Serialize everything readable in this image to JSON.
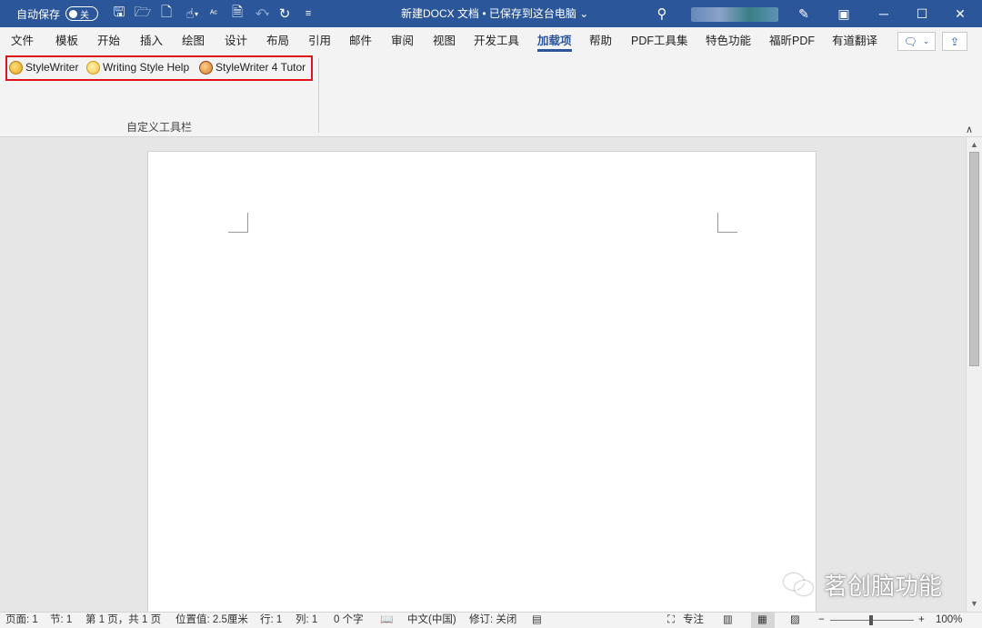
{
  "titlebar": {
    "autosave_label": "自动保存",
    "autosave_state": "关",
    "doc_title": "新建DOCX 文档 • 已保存到这台电脑 ⌄",
    "icons": [
      "save-icon",
      "open-folder-icon",
      "new-document-icon",
      "touch-mode-icon",
      "spelling-icon",
      "print-preview-icon",
      "undo-icon",
      "redo-icon",
      "customize-qat-icon"
    ]
  },
  "tabs": [
    "文件",
    "模板",
    "开始",
    "插入",
    "绘图",
    "设计",
    "布局",
    "引用",
    "邮件",
    "审阅",
    "视图",
    "开发工具",
    "加载项",
    "帮助",
    "PDF工具集",
    "特色功能",
    "福昕PDF",
    "有道翻译"
  ],
  "active_tab": "加载项",
  "ribbon": {
    "items": [
      {
        "label": "StyleWriter",
        "icon": "stylewriter-icon"
      },
      {
        "label": "Writing Style Help",
        "icon": "writing-style-help-icon"
      },
      {
        "label": "StyleWriter 4 Tutor",
        "icon": "stylewriter-tutor-icon"
      }
    ],
    "group_label": "自定义工具栏",
    "highlight_color": "#e0151c"
  },
  "watermark": "茗创脑功能",
  "statusbar": {
    "page": "页面: 1",
    "section": "节: 1",
    "page_of": "第 1 页，共 1 页",
    "position": "位置值: 2.5厘米",
    "line": "行: 1",
    "column": "列: 1",
    "word_count": "0 个字",
    "language": "中文(中国)",
    "track_changes": "修订: 关闭",
    "focus": "专注",
    "zoom_minus": "−",
    "zoom_plus": "+",
    "zoom_level": "100%"
  },
  "colors": {
    "titlebar": "#2b579a",
    "accent": "#2b579a"
  }
}
